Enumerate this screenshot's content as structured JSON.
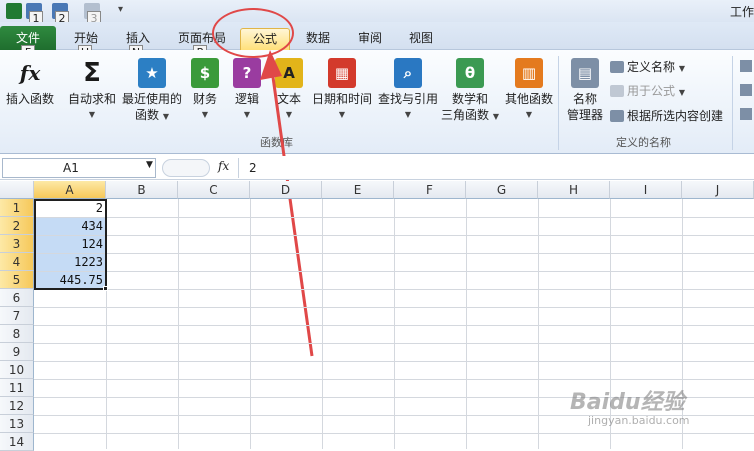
{
  "titlebar": {
    "title": "工作"
  },
  "quick_access_keytips": [
    "1",
    "2",
    "3"
  ],
  "tabs": [
    {
      "label": "文件",
      "keytip": "F"
    },
    {
      "label": "开始",
      "keytip": "H"
    },
    {
      "label": "插入",
      "keytip": "N"
    },
    {
      "label": "页面布局",
      "keytip": "P"
    },
    {
      "label": "公式"
    },
    {
      "label": "数据"
    },
    {
      "label": "审阅"
    },
    {
      "label": "视图"
    }
  ],
  "ribbon": {
    "function_library": {
      "group_label": "函数库",
      "buttons": [
        {
          "label": "插入函数",
          "icon": "fx-icon",
          "color": "#1a1a1a"
        },
        {
          "label": "自动求和",
          "icon": "sigma-icon",
          "color": "#1a1a1a"
        },
        {
          "label": "最近使用的",
          "label2": "函数",
          "icon": "star-book-icon",
          "color": "#2c7fc4"
        },
        {
          "label": "财务",
          "icon": "finance-book-icon",
          "color": "#3a9a3a"
        },
        {
          "label": "逻辑",
          "icon": "question-book-icon",
          "color": "#9a3ca0"
        },
        {
          "label": "文本",
          "icon": "text-book-icon",
          "color": "#e2b41a"
        },
        {
          "label": "日期和时间",
          "icon": "calendar-book-icon",
          "color": "#d33a2c"
        },
        {
          "label": "查找与引用",
          "icon": "magnifier-book-icon",
          "color": "#2a78c2"
        },
        {
          "label": "数学和",
          "label2": "三角函数",
          "icon": "theta-book-icon",
          "color": "#3b9a52"
        },
        {
          "label": "其他函数",
          "icon": "more-books-icon",
          "color": "#e47a1e"
        }
      ]
    },
    "defined_names": {
      "group_label": "定义的名称",
      "name_manager": {
        "label": "名称",
        "label2": "管理器"
      },
      "define_name": "定义名称",
      "use_in_formula": "用于公式",
      "create_from_selection": "根据所选内容创建"
    }
  },
  "formula_bar": {
    "name_box": "A1",
    "fx_label": "fx",
    "value": "2"
  },
  "grid": {
    "columns": [
      "A",
      "B",
      "C",
      "D",
      "E",
      "F",
      "G",
      "H",
      "I",
      "J"
    ],
    "rows": [
      "1",
      "2",
      "3",
      "4",
      "5",
      "6",
      "7",
      "8",
      "9",
      "10",
      "11",
      "12",
      "13",
      "14"
    ],
    "column_a_values": [
      "2",
      "434",
      "124",
      "1223",
      "445.75"
    ]
  },
  "colors": {
    "accent_file_tab": "#217a33",
    "selection_fill": "#c5dbf5",
    "annotation_red": "#e04848"
  },
  "watermark": {
    "text": "Baidu经验",
    "url_text": "jingyan.baidu.com"
  }
}
